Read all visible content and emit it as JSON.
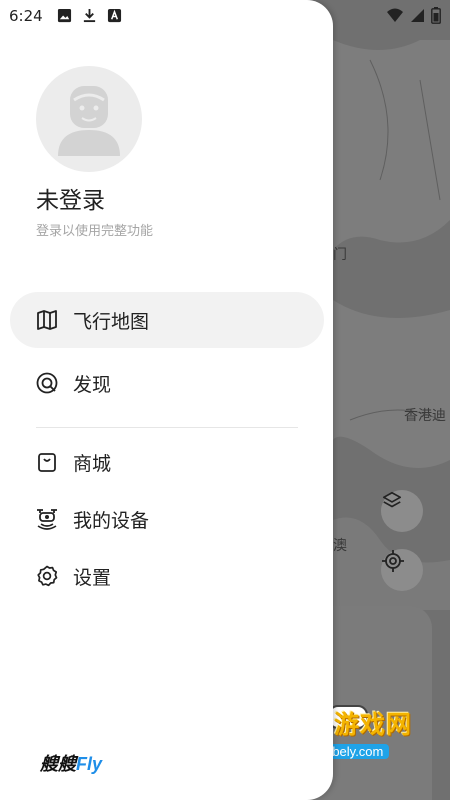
{
  "status_bar": {
    "time": "6:24",
    "left_icons": [
      "image-icon",
      "download-icon",
      "app-store-icon"
    ],
    "right_icons": [
      "wifi-icon",
      "signal-icon",
      "battery-icon"
    ]
  },
  "map": {
    "labels": [
      "门",
      "香港迪",
      "澳"
    ],
    "buttons": [
      "layers-icon",
      "locate-icon"
    ]
  },
  "watermark": {
    "title": "宝贝游戏网",
    "url": "baobely.com"
  },
  "user": {
    "name": "未登录",
    "subtitle": "登录以使用完整功能"
  },
  "menu": [
    {
      "label": "飞行地图",
      "icon": "map-icon",
      "active": true
    },
    {
      "label": "发现",
      "icon": "discover-icon",
      "active": false
    },
    {
      "label": "商城",
      "icon": "shopping-bag-icon",
      "active": false
    },
    {
      "label": "我的设备",
      "icon": "drone-device-icon",
      "active": false
    },
    {
      "label": "设置",
      "icon": "gear-icon",
      "active": false
    }
  ],
  "brand": {
    "part1": "艘艘",
    "part2": "Fly"
  }
}
